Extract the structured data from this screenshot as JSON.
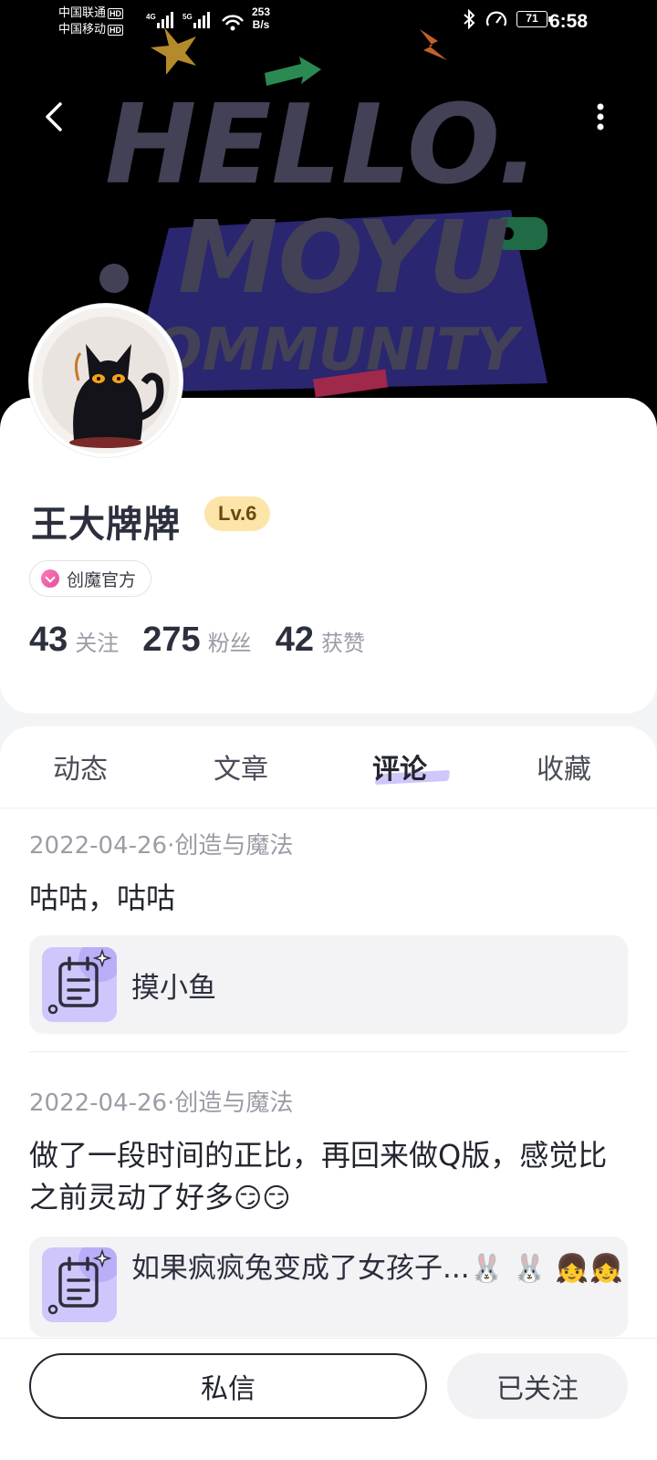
{
  "status_bar": {
    "carrier1": "中国联通",
    "carrier2": "中国移动",
    "hd": "HD",
    "network1": "4G",
    "network2": "5G",
    "speed_value": "253",
    "speed_unit": "B/s",
    "battery": "71",
    "time": "6:58"
  },
  "banner": {
    "line1": "HELLO.",
    "line2": "MOYU",
    "line3": "COMMUNITY"
  },
  "profile": {
    "username": "王大牌牌",
    "level": "Lv.6",
    "official_tag": "创魔官方",
    "stats": [
      {
        "value": "43",
        "label": "关注"
      },
      {
        "value": "275",
        "label": "粉丝"
      },
      {
        "value": "42",
        "label": "获赞"
      }
    ]
  },
  "tabs": [
    {
      "label": "动态",
      "active": false
    },
    {
      "label": "文章",
      "active": false
    },
    {
      "label": "评论",
      "active": true
    },
    {
      "label": "收藏",
      "active": false
    }
  ],
  "posts": [
    {
      "meta": "2022-04-26·创造与魔法",
      "text": "咕咕，咕咕",
      "quote": "摸小鱼"
    },
    {
      "meta": "2022-04-26·创造与魔法",
      "text": "做了一段时间的正比，再回来做Q版，感觉比之前灵动了好多",
      "text_emoji": "😏😏",
      "quote": "如果疯疯兔变成了女孩子...",
      "quote_emoji": "🐰 🐰 👧👧"
    }
  ],
  "actions": {
    "message": "私信",
    "followed": "已关注"
  },
  "colors": {
    "accent_purple": "#cfc6fb",
    "level_bg": "#fde4a8",
    "official_pink": "#e0529a"
  }
}
